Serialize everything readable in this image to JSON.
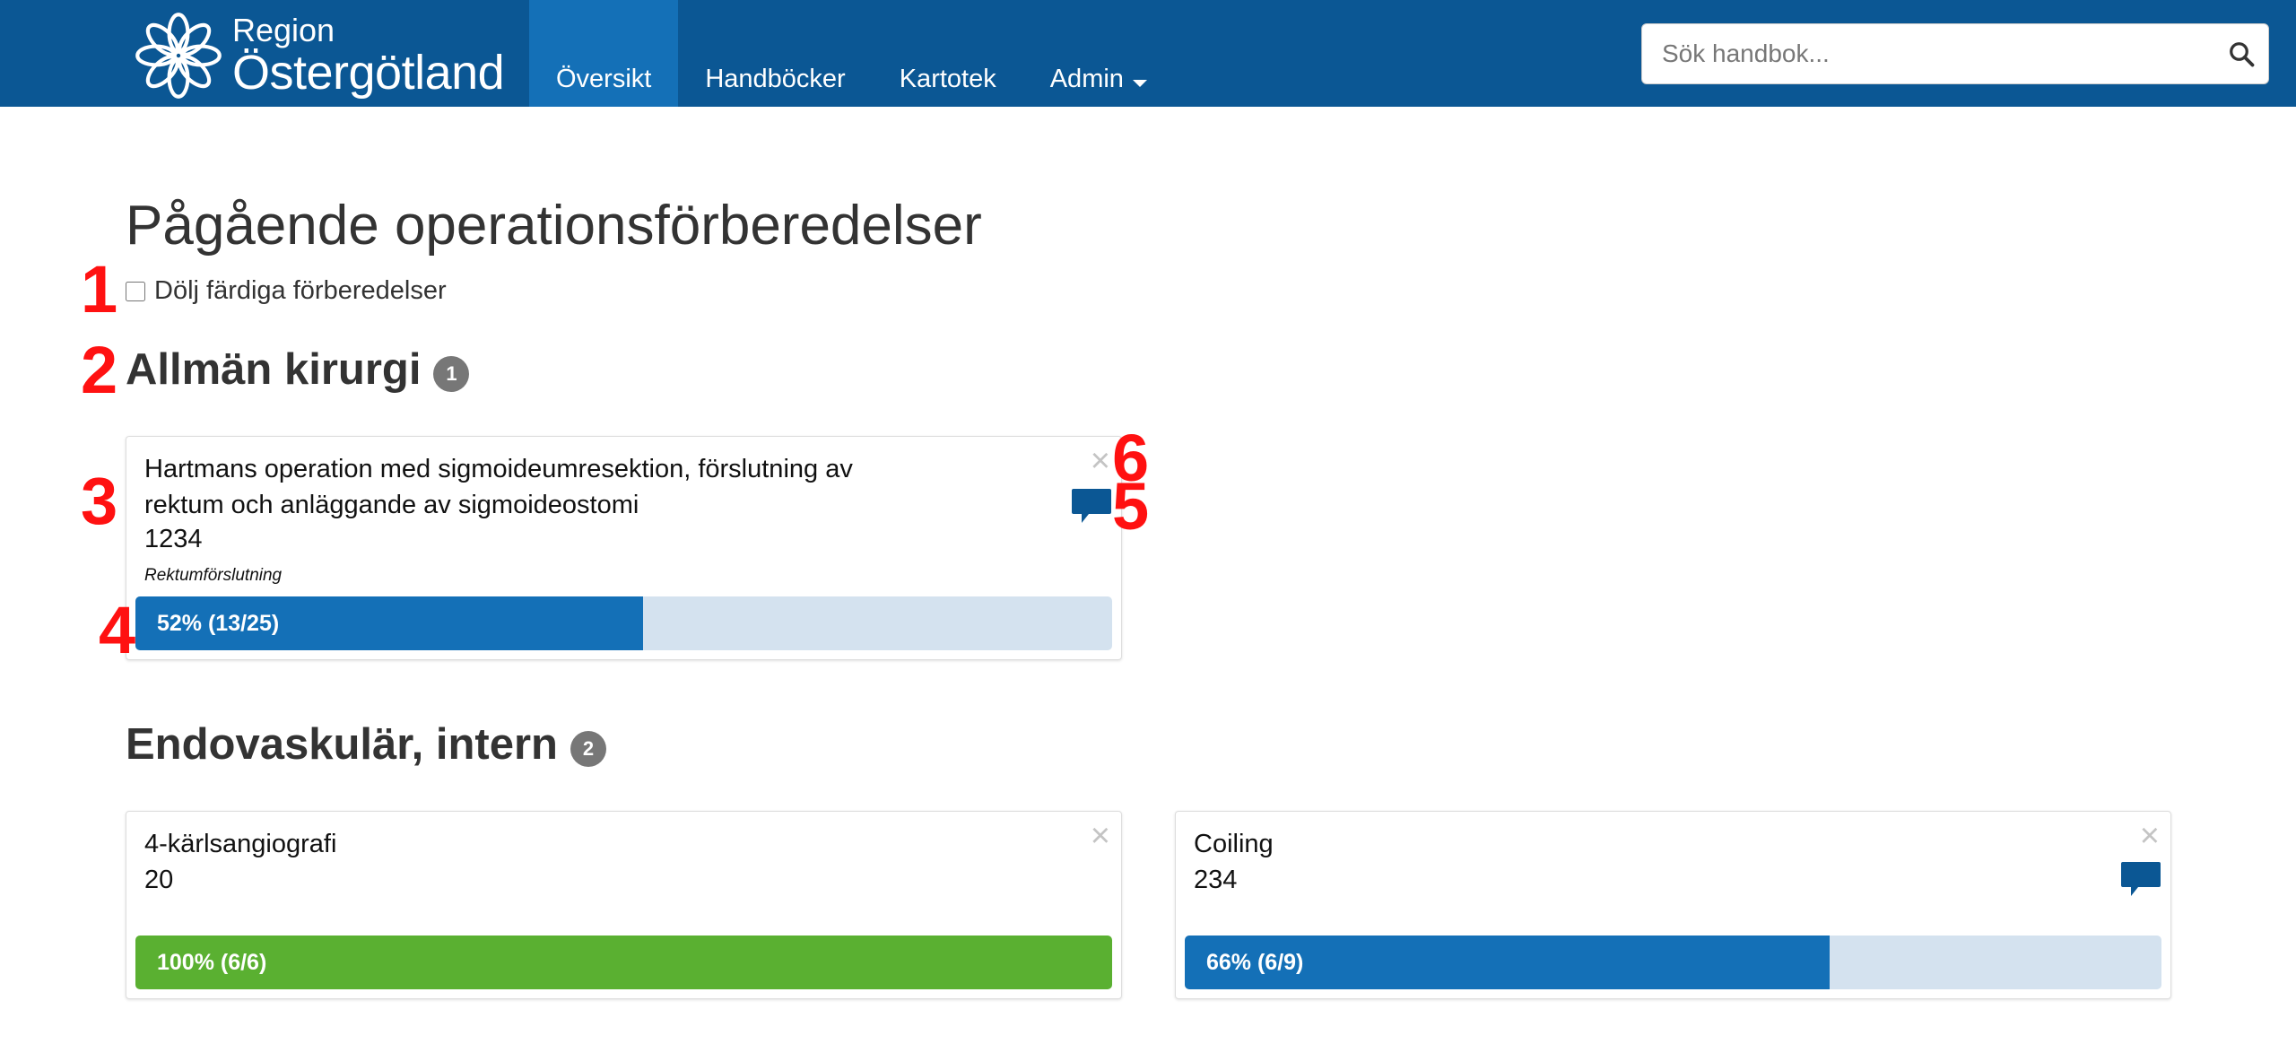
{
  "brand": {
    "line1": "Region",
    "line2": "Östergötland"
  },
  "nav": [
    {
      "label": "Översikt",
      "active": true
    },
    {
      "label": "Handböcker"
    },
    {
      "label": "Kartotek"
    },
    {
      "label": "Admin"
    }
  ],
  "search": {
    "placeholder": "Sök handbok...",
    "value": ""
  },
  "page": {
    "title": "Pågående operationsförberedelser",
    "hide_completed_label": "Dölj färdiga förberedelser",
    "hide_completed_checked": false
  },
  "sections": [
    {
      "title": "Allmän kirurgi",
      "count": "1",
      "cards": [
        {
          "title": "Hartmans operation med sigmoideumresektion, förslutning av rektum och anläggande av sigmoideostomi",
          "code": "1234",
          "subtitle": "Rektumförslutning",
          "progress_label": "52% (13/25)",
          "progress_fraction": 0.52,
          "progress_color": "#1470b7",
          "has_comment": true
        }
      ]
    },
    {
      "title": "Endovaskulär, intern",
      "count": "2",
      "cards": [
        {
          "title": "4-kärlsangiografi",
          "code": "20",
          "progress_label": "100% (6/6)",
          "progress_fraction": 1.0,
          "progress_color": "#5ab031",
          "has_comment": false
        },
        {
          "title": "Coiling",
          "code": "234",
          "progress_label": "66% (6/9)",
          "progress_fraction": 0.66,
          "progress_color": "#1470b7",
          "has_comment": true
        }
      ]
    }
  ],
  "annotations": [
    "1",
    "2",
    "3",
    "4",
    "5",
    "6"
  ],
  "colors": {
    "navbar": "#0b5794",
    "nav_active": "#1470b7",
    "progress_blue": "#1470b7",
    "progress_green": "#5ab031",
    "progress_track": "#d4e2ef",
    "annotation": "#ff1111",
    "comment_icon": "#0b5794"
  }
}
